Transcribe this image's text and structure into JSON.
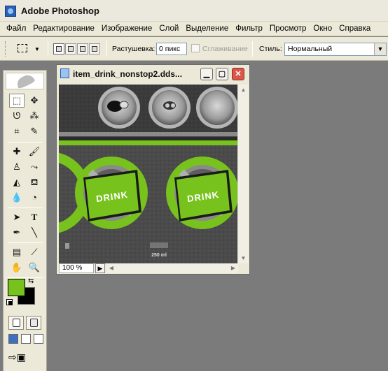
{
  "app": {
    "title": "Adobe Photoshop"
  },
  "menu": [
    "Файл",
    "Редактирование",
    "Изображение",
    "Слой",
    "Выделение",
    "Фильтр",
    "Просмотр",
    "Окно",
    "Справка"
  ],
  "options": {
    "feather_label": "Растушевка:",
    "feather_value": "0 пикс",
    "antialias_label": "Сглаживание",
    "antialias_checked": false,
    "style_label": "Стиль:",
    "style_value": "Нормальный"
  },
  "colors": {
    "foreground": "#78c21e",
    "background": "#000000",
    "accent_green": "#78c21e"
  },
  "document": {
    "title": "item_drink_nonstop2.dds...",
    "zoom": "100 %",
    "canvas_texts": {
      "drink1": "DRINK",
      "drink2": "DRINK",
      "volume": "250 ml"
    }
  },
  "tools": [
    "rect-marquee-icon",
    "move-icon",
    "lasso-icon",
    "magic-wand-icon",
    "crop-icon",
    "slice-icon",
    "healing-brush-icon",
    "brush-icon",
    "clone-stamp-icon",
    "history-brush-icon",
    "eraser-icon",
    "paint-bucket-icon",
    "blur-icon",
    "dodge-icon",
    "path-selection-icon",
    "type-icon",
    "pen-icon",
    "line-icon",
    "notes-icon",
    "eyedropper-icon",
    "hand-icon",
    "zoom-icon"
  ]
}
